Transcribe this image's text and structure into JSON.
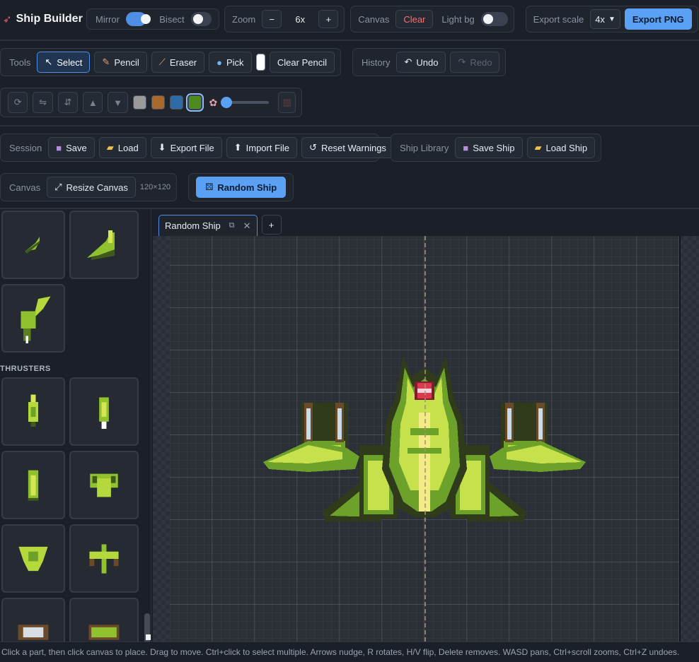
{
  "app": {
    "title": "Ship Builder",
    "logo_icon": "rocket-icon"
  },
  "toolbar1": {
    "mirror_label": "Mirror",
    "mirror_on": true,
    "bisect_label": "Bisect",
    "bisect_on": false,
    "zoom_label": "Zoom",
    "zoom_out": "−",
    "zoom_value": "6x",
    "zoom_in": "+",
    "canvas_label": "Canvas",
    "clear_label": "Clear",
    "lightbg_label": "Light bg",
    "lightbg_on": false,
    "export_scale_label": "Export scale",
    "export_scale_value": "4x",
    "export_png_label": "Export PNG"
  },
  "tools": {
    "label": "Tools",
    "select": "Select",
    "pencil": "Pencil",
    "eraser": "Eraser",
    "pick": "Pick",
    "clear_pencil": "Clear Pencil",
    "active": "select",
    "pencil_color": "#ffffff"
  },
  "history": {
    "label": "History",
    "undo": "Undo",
    "redo": "Redo"
  },
  "transform": {
    "swatches": [
      "#9a9a9a",
      "#a8692c",
      "#2e6aa6",
      "#4e8a1e"
    ],
    "selected_swatch": 3,
    "icons": [
      "rotate-icon",
      "flip-horizontal-icon",
      "flip-vertical-icon",
      "move-up-icon",
      "move-down-icon",
      "palette-icon",
      "trash-icon"
    ]
  },
  "session": {
    "label": "Session",
    "save": "Save",
    "load": "Load",
    "export_file": "Export File",
    "import_file": "Import File",
    "reset_warnings": "Reset Warnings"
  },
  "library": {
    "label": "Ship Library",
    "save_ship": "Save Ship",
    "load_ship": "Load Ship"
  },
  "canvas_row": {
    "label": "Canvas",
    "resize": "Resize Canvas",
    "size": "120×120",
    "random_ship": "Random Ship"
  },
  "palette": {
    "section": "THRUSTERS"
  },
  "tabs": [
    {
      "label": "Random Ship"
    }
  ],
  "status": "Click a part, then click canvas to place. Drag to move. Ctrl+click to select multiple. Arrows nudge, R rotates, H/V flip, Delete removes. WASD pans, Ctrl+scroll zooms, Ctrl+Z undoes.",
  "colors": {
    "accent": "#4f8fe6",
    "primary": "#5aa1f5",
    "danger": "#ff6b6b",
    "ship_dark": "#2f3b1b",
    "ship_mid": "#6da22a",
    "ship_light": "#c7e14c",
    "ship_hi": "#f2eb86",
    "cockpit": "#d93a4f"
  }
}
